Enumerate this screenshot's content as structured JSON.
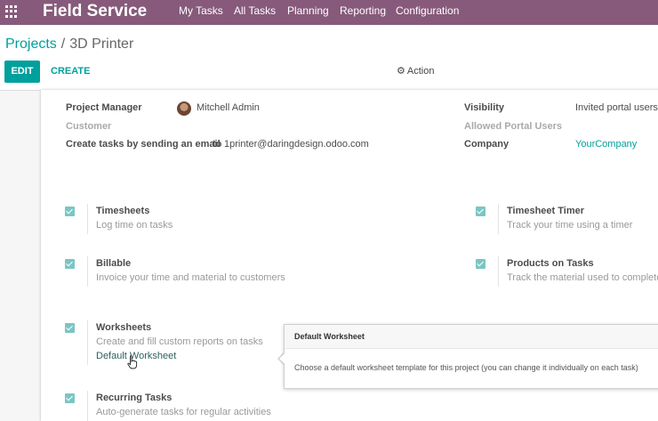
{
  "topbar": {
    "app_title": "Field Service",
    "menu": [
      "My Tasks",
      "All Tasks",
      "Planning",
      "Reporting",
      "Configuration"
    ]
  },
  "breadcrumb": {
    "parent": "Projects",
    "separator": "/",
    "current": "3D Printer"
  },
  "toolbar": {
    "edit_label": "EDIT",
    "create_label": "CREATE",
    "action_label": "Action"
  },
  "form": {
    "project_manager_label": "Project Manager",
    "project_manager_value": "Mitchell Admin",
    "customer_label": "Customer",
    "email_label": "Create tasks by sending an email",
    "email_to": "to",
    "email_value": "1printer@daringdesign.odoo.com",
    "visibility_label": "Visibility",
    "visibility_value": "Invited portal users",
    "allowed_users_label": "Allowed Portal Users",
    "company_label": "Company",
    "company_value": "YourCompany"
  },
  "options": {
    "timesheets": {
      "title": "Timesheets",
      "desc": "Log time on tasks",
      "checked": true
    },
    "timesheet_timer": {
      "title": "Timesheet Timer",
      "desc": "Track your time using a timer",
      "checked": true
    },
    "billable": {
      "title": "Billable",
      "desc": "Invoice your time and material to customers",
      "checked": true
    },
    "products_on_tasks": {
      "title": "Products on Tasks",
      "desc": "Track the material used to complete",
      "checked": true
    },
    "worksheets": {
      "title": "Worksheets",
      "desc": "Create and fill custom reports on tasks",
      "link": "Default Worksheet",
      "checked": true
    },
    "recurring_tasks": {
      "title": "Recurring Tasks",
      "desc": "Auto-generate tasks for regular activities",
      "checked": true
    }
  },
  "tooltip": {
    "title": "Default Worksheet",
    "body": "Choose a default worksheet template for this project (you can change it individually on each task)"
  },
  "colors": {
    "brand": "#875a7b",
    "accent": "#00a09d",
    "checkbox": "#7ac6c4"
  },
  "icons": {
    "apps": "grid-icon",
    "action": "gear-icon",
    "cursor": "hand-pointer-icon"
  }
}
